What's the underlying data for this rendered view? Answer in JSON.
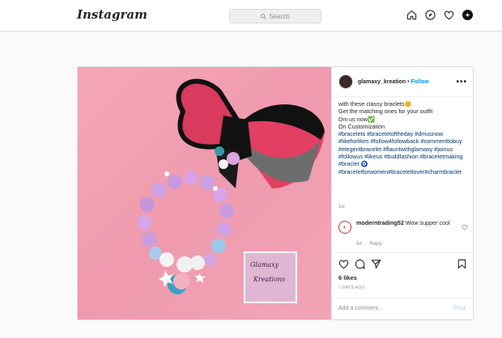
{
  "header": {
    "logo": "Instagram",
    "search_placeholder": "Search",
    "icons": [
      "home-icon",
      "explore-icon",
      "heart-icon",
      "profile-avatar"
    ]
  },
  "post": {
    "username": "glamaxy_kreation",
    "separator": "•",
    "follow_label": "Follow",
    "more_label": "•••",
    "caption_lines": [
      "with these classy braclets😊",
      "Get the matching ones for your outfit",
      "Dm us now✅",
      "On Customization"
    ],
    "hashtags": "#bracelets #braceletoftheday #dmusnow #likeforlikes #follow4followback #commenttobuy #elegentbracelet #flauntwithglamaxy #joinus #followus #likeus #buildfashion #braceletmaking #braclet 🧿 #braceletforwomen#braceletlover#charmbraclet",
    "posted_age": "1w",
    "comment": {
      "user": "moderntrading52",
      "text": "Wow supper cool",
      "age": "5d",
      "reply_label": "Reply"
    },
    "likes": "6 likes",
    "date": "7 DAYS AGO",
    "add_comment_placeholder": "Add a comment...",
    "post_button": "Post",
    "watermark_line1": "Glamaxy",
    "watermark_line2": "Kreations"
  },
  "colors": {
    "link": "#0095f6",
    "hashtag": "#00376b",
    "photo_background": "#f2a5b6"
  }
}
